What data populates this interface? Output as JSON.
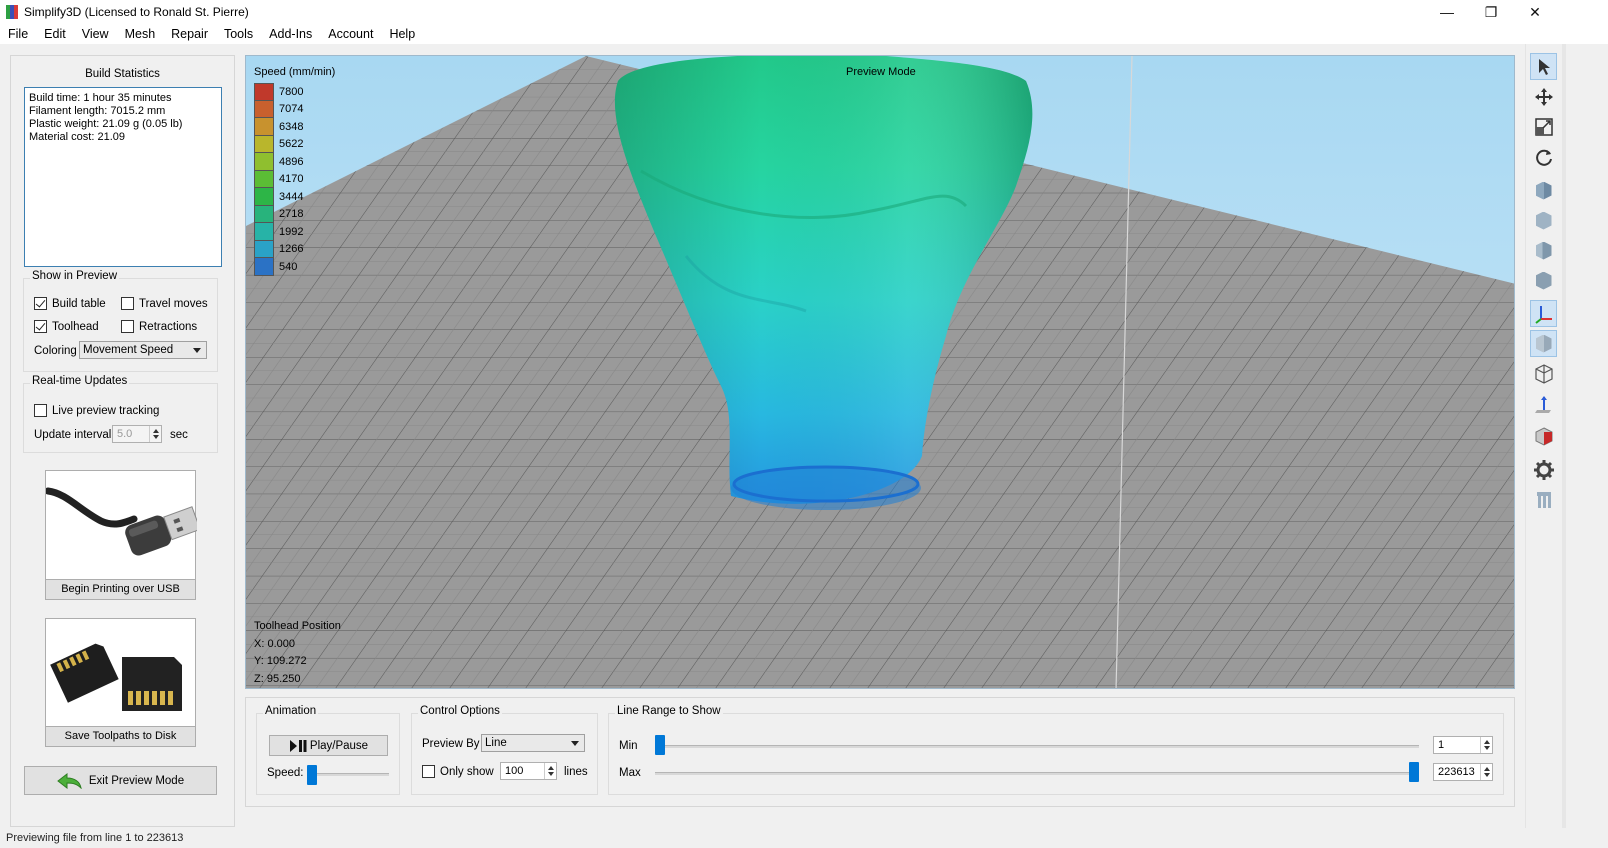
{
  "window": {
    "title": "Simplify3D (Licensed to Ronald St. Pierre)",
    "minimize": "—",
    "restore": "❐",
    "close": "✕",
    "icon_colors": [
      "#2ea043",
      "#3b4fb8",
      "#d93a3a"
    ]
  },
  "menu": [
    "File",
    "Edit",
    "View",
    "Mesh",
    "Repair",
    "Tools",
    "Add-Ins",
    "Account",
    "Help"
  ],
  "build_statistics": {
    "title": "Build Statistics",
    "lines": [
      "Build time: 1 hour 35 minutes",
      "Filament length: 7015.2 mm",
      "Plastic weight: 21.09 g (0.05 lb)",
      "Material cost: 21.09"
    ]
  },
  "show_in_preview": {
    "title": "Show in Preview",
    "build_table": {
      "label": "Build table",
      "checked": true
    },
    "travel_moves": {
      "label": "Travel moves",
      "checked": false
    },
    "toolhead": {
      "label": "Toolhead",
      "checked": true
    },
    "retractions": {
      "label": "Retractions",
      "checked": false
    },
    "coloring_label": "Coloring",
    "coloring_value": "Movement Speed"
  },
  "realtime": {
    "title": "Real-time Updates",
    "live_preview": {
      "label": "Live preview tracking",
      "checked": false
    },
    "interval_label": "Update interval",
    "interval_value": "5.0",
    "interval_unit": "sec"
  },
  "buttons": {
    "usb": "Begin Printing over USB",
    "sd": "Save Toolpaths to Disk",
    "exit": "Exit Preview Mode"
  },
  "viewport": {
    "legend_title": "Speed (mm/min)",
    "mode_label": "Preview Mode",
    "legend": [
      {
        "value": "7800",
        "color": "#c0392b"
      },
      {
        "value": "7074",
        "color": "#c8602e"
      },
      {
        "value": "6348",
        "color": "#c8922e"
      },
      {
        "value": "5622",
        "color": "#b9b62c"
      },
      {
        "value": "4896",
        "color": "#8fbf2f"
      },
      {
        "value": "4170",
        "color": "#5bbd35"
      },
      {
        "value": "3444",
        "color": "#2db547"
      },
      {
        "value": "2718",
        "color": "#28b37c"
      },
      {
        "value": "1992",
        "color": "#27b3a7"
      },
      {
        "value": "1266",
        "color": "#2aa2c7"
      },
      {
        "value": "540",
        "color": "#2b72c5"
      }
    ],
    "toolhead_title": "Toolhead Position",
    "x": "X: 0.000",
    "y": "Y: 109.272",
    "z": "Z: 95.250"
  },
  "toolbar_icons": [
    "select-icon",
    "move-icon",
    "scale-icon",
    "rotate-icon",
    "view-iso-icon",
    "view-front-icon",
    "view-side-icon",
    "view-back-icon",
    "axes-icon",
    "solid-view-icon",
    "wireframe-icon",
    "normals-icon",
    "cross-section-icon",
    "settings-gear-icon",
    "supports-icon"
  ],
  "animation": {
    "title": "Animation",
    "play_pause": "Play/Pause",
    "speed_label": "Speed:",
    "speed_level": 0.0
  },
  "control_options": {
    "title": "Control Options",
    "preview_by_label": "Preview By",
    "preview_by_value": "Line",
    "only_show_label": "Only show",
    "only_show_checked": false,
    "only_show_value": "100",
    "only_show_unit": "lines"
  },
  "line_range": {
    "title": "Line Range to Show",
    "min_label": "Min",
    "max_label": "Max",
    "min_value": "1",
    "max_value": "223613",
    "min_fraction": 0.0,
    "max_fraction": 1.0
  },
  "status": {
    "text": "Previewing file from line 1 to 223613"
  }
}
